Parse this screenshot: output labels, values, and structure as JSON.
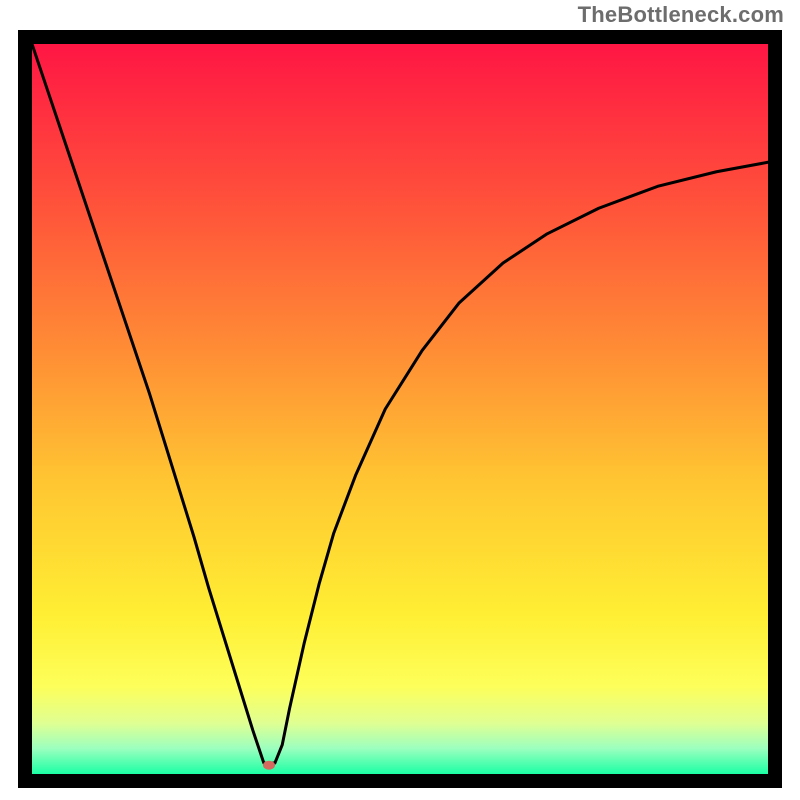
{
  "watermark": "TheBottleneck.com",
  "chart_data": {
    "type": "line",
    "title": "",
    "xlabel": "",
    "ylabel": "",
    "xlim": [
      0,
      100
    ],
    "ylim": [
      0,
      100
    ],
    "grid": false,
    "background_gradient_stops": [
      {
        "offset": 0.0,
        "color": "#ff1644"
      },
      {
        "offset": 0.23,
        "color": "#ff553a"
      },
      {
        "offset": 0.42,
        "color": "#ff8d35"
      },
      {
        "offset": 0.6,
        "color": "#ffc632"
      },
      {
        "offset": 0.78,
        "color": "#ffee33"
      },
      {
        "offset": 0.88,
        "color": "#fdff5a"
      },
      {
        "offset": 0.93,
        "color": "#e0ff92"
      },
      {
        "offset": 0.965,
        "color": "#9cffbf"
      },
      {
        "offset": 1.0,
        "color": "#1bffa4"
      }
    ],
    "series": [
      {
        "name": "bottleneck-curve",
        "x": [
          0,
          2,
          4,
          6,
          8,
          10,
          12,
          14,
          16,
          18,
          20,
          22,
          24,
          26,
          28,
          30,
          31.5,
          33,
          34,
          35,
          37,
          39,
          41,
          44,
          48,
          53,
          58,
          64,
          70,
          77,
          85,
          93,
          100
        ],
        "y": [
          100,
          94,
          88,
          82,
          76,
          70,
          64,
          58,
          52,
          45.5,
          39,
          32.5,
          25.5,
          19,
          12.5,
          6,
          1.5,
          1.5,
          4,
          9,
          18,
          26,
          33,
          41,
          50,
          58,
          64.5,
          70,
          74,
          77.5,
          80.5,
          82.5,
          83.8
        ]
      }
    ],
    "marker": {
      "name": "optimal-point",
      "x": 32.2,
      "y": 1.2,
      "color": "#d46a5f",
      "rx": 6,
      "ry": 4.5
    }
  }
}
